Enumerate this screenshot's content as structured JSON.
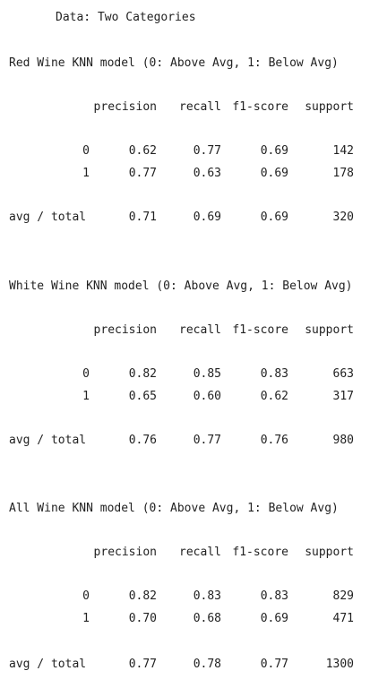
{
  "header": {
    "data_title": "Data: Two Categories"
  },
  "columns": {
    "precision": "precision",
    "recall": "recall",
    "f1": "f1-score",
    "support": "support"
  },
  "reports": [
    {
      "title": "Red Wine KNN model (0: Above Avg, 1: Below Avg)",
      "rows": [
        {
          "label": "0",
          "precision": "0.62",
          "recall": "0.77",
          "f1": "0.69",
          "support": "142"
        },
        {
          "label": "1",
          "precision": "0.77",
          "recall": "0.63",
          "f1": "0.69",
          "support": "178"
        }
      ],
      "total": {
        "label": "avg / total",
        "precision": "0.71",
        "recall": "0.69",
        "f1": "0.69",
        "support": "320"
      }
    },
    {
      "title": "White Wine KNN model (0: Above Avg, 1: Below Avg)",
      "rows": [
        {
          "label": "0",
          "precision": "0.82",
          "recall": "0.85",
          "f1": "0.83",
          "support": "663"
        },
        {
          "label": "1",
          "precision": "0.65",
          "recall": "0.60",
          "f1": "0.62",
          "support": "317"
        }
      ],
      "total": {
        "label": "avg / total",
        "precision": "0.76",
        "recall": "0.77",
        "f1": "0.76",
        "support": "980"
      }
    },
    {
      "title": "All Wine KNN model (0: Above Avg, 1: Below Avg)",
      "rows": [
        {
          "label": "0",
          "precision": "0.82",
          "recall": "0.83",
          "f1": "0.83",
          "support": "829"
        },
        {
          "label": "1",
          "precision": "0.70",
          "recall": "0.68",
          "f1": "0.69",
          "support": "471"
        }
      ],
      "total": {
        "label": "avg / total",
        "precision": "0.77",
        "recall": "0.78",
        "f1": "0.77",
        "support": "1300"
      }
    }
  ]
}
